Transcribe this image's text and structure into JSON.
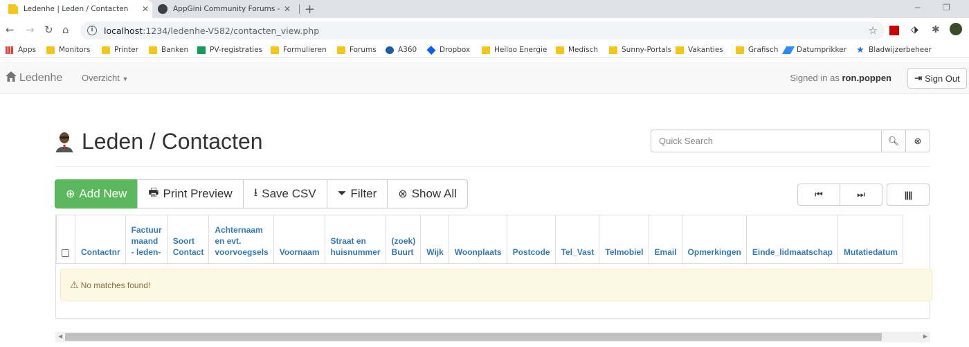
{
  "browser": {
    "tabs": [
      {
        "title": "Ledenhe | Leden / Contacten",
        "active": true
      },
      {
        "title": "AppGini Community Forums - Po",
        "active": false
      }
    ],
    "url_host": "localhost",
    "url_path": ":1234/ledenhe-V582/contacten_view.php",
    "bookmarks": [
      {
        "label": "Apps",
        "icon": "apps-grid-icon"
      },
      {
        "label": "Monitors",
        "icon": "folder-icon"
      },
      {
        "label": "Printer",
        "icon": "folder-icon"
      },
      {
        "label": "Banken",
        "icon": "folder-icon"
      },
      {
        "label": "PV-registraties",
        "icon": "sheets-icon"
      },
      {
        "label": "Formulieren",
        "icon": "folder-icon"
      },
      {
        "label": "Forums",
        "icon": "folder-icon"
      },
      {
        "label": "A360",
        "icon": "a360-icon"
      },
      {
        "label": "Dropbox",
        "icon": "dropbox-icon"
      },
      {
        "label": "Heiloo Energie",
        "icon": "folder-icon"
      },
      {
        "label": "Medisch",
        "icon": "folder-icon"
      },
      {
        "label": "Sunny-Portals",
        "icon": "folder-icon"
      },
      {
        "label": "Vakanties",
        "icon": "folder-icon"
      },
      {
        "label": "Grafisch",
        "icon": "folder-icon"
      },
      {
        "label": "Datumprikker",
        "icon": "datumprikker-icon"
      },
      {
        "label": "Bladwijzerbeheer",
        "icon": "star-icon"
      }
    ]
  },
  "app": {
    "brand": "Ledenhe",
    "menu": "Overzicht",
    "signed_in_prefix": "Signed in as",
    "username": "ron.poppen",
    "sign_out": "Sign Out"
  },
  "page": {
    "title": "Leden / Contacten",
    "search_placeholder": "Quick Search",
    "buttons": {
      "add_new": "Add New",
      "print_preview": "Print Preview",
      "save_csv": "Save CSV",
      "filter": "Filter",
      "show_all": "Show All"
    },
    "columns": [
      [
        "Contactnr"
      ],
      [
        "Factuur",
        "maand",
        "- leden-"
      ],
      [
        "Soort",
        "Contact"
      ],
      [
        "Achternaam",
        "en evt.",
        "voorvoegsels"
      ],
      [
        "Voornaam"
      ],
      [
        "Straat en",
        "huisnummer"
      ],
      [
        "(zoek)",
        "Buurt"
      ],
      [
        "Wijk"
      ],
      [
        "Woonplaats"
      ],
      [
        "Postcode"
      ],
      [
        "Tel_Vast"
      ],
      [
        "Telmobiel"
      ],
      [
        "Email"
      ],
      [
        "Opmerkingen"
      ],
      [
        "Einde_lidmaatschap"
      ],
      [
        "Mutatiedatum"
      ]
    ],
    "no_matches": "No matches found!"
  },
  "colors": {
    "success": "#5cb85c",
    "link": "#337ab7",
    "alert_bg": "#fcf8e3",
    "alert_text": "#8a6d3b"
  }
}
